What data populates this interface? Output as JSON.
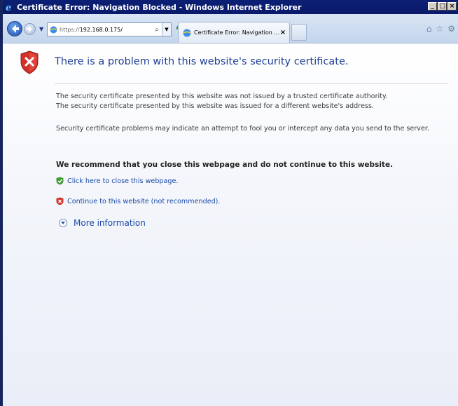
{
  "window": {
    "title": "Certificate Error: Navigation Blocked - Windows Internet Explorer",
    "min_label": "_",
    "max_label": "□",
    "close_label": "×"
  },
  "navbar": {
    "address_proto": "https://",
    "address_host": "192.168.0.175/",
    "search_glyph": "⌕",
    "dropdown_glyph": "▼",
    "refresh_glyph": "⁴⁺",
    "tab_title": "Certificate Error: Navigation ...",
    "tab_close": "×",
    "tool_icons": [
      "home-icon",
      "favorites-star-icon",
      "tools-gear-icon"
    ]
  },
  "content": {
    "heading": "There is a problem with this website's security certificate.",
    "para1": "The security certificate presented by this website was not issued by a trusted certificate authority.",
    "para2": "The security certificate presented by this website was issued for a different website's address.",
    "para3": "Security certificate problems may indicate an attempt to fool you or intercept any data you send to the server.",
    "recommend": "We recommend that you close this webpage and do not continue to this website.",
    "close_link": "Click here to close this webpage.",
    "continue_link": "Continue to this website (not recommended).",
    "more_info": "More information"
  },
  "colors": {
    "title_bar": "#0b1f74",
    "heading": "#1f3f96",
    "link": "#1b4aa8",
    "error_shield": "#d4302a",
    "safe_shield": "#3f9b2f"
  }
}
